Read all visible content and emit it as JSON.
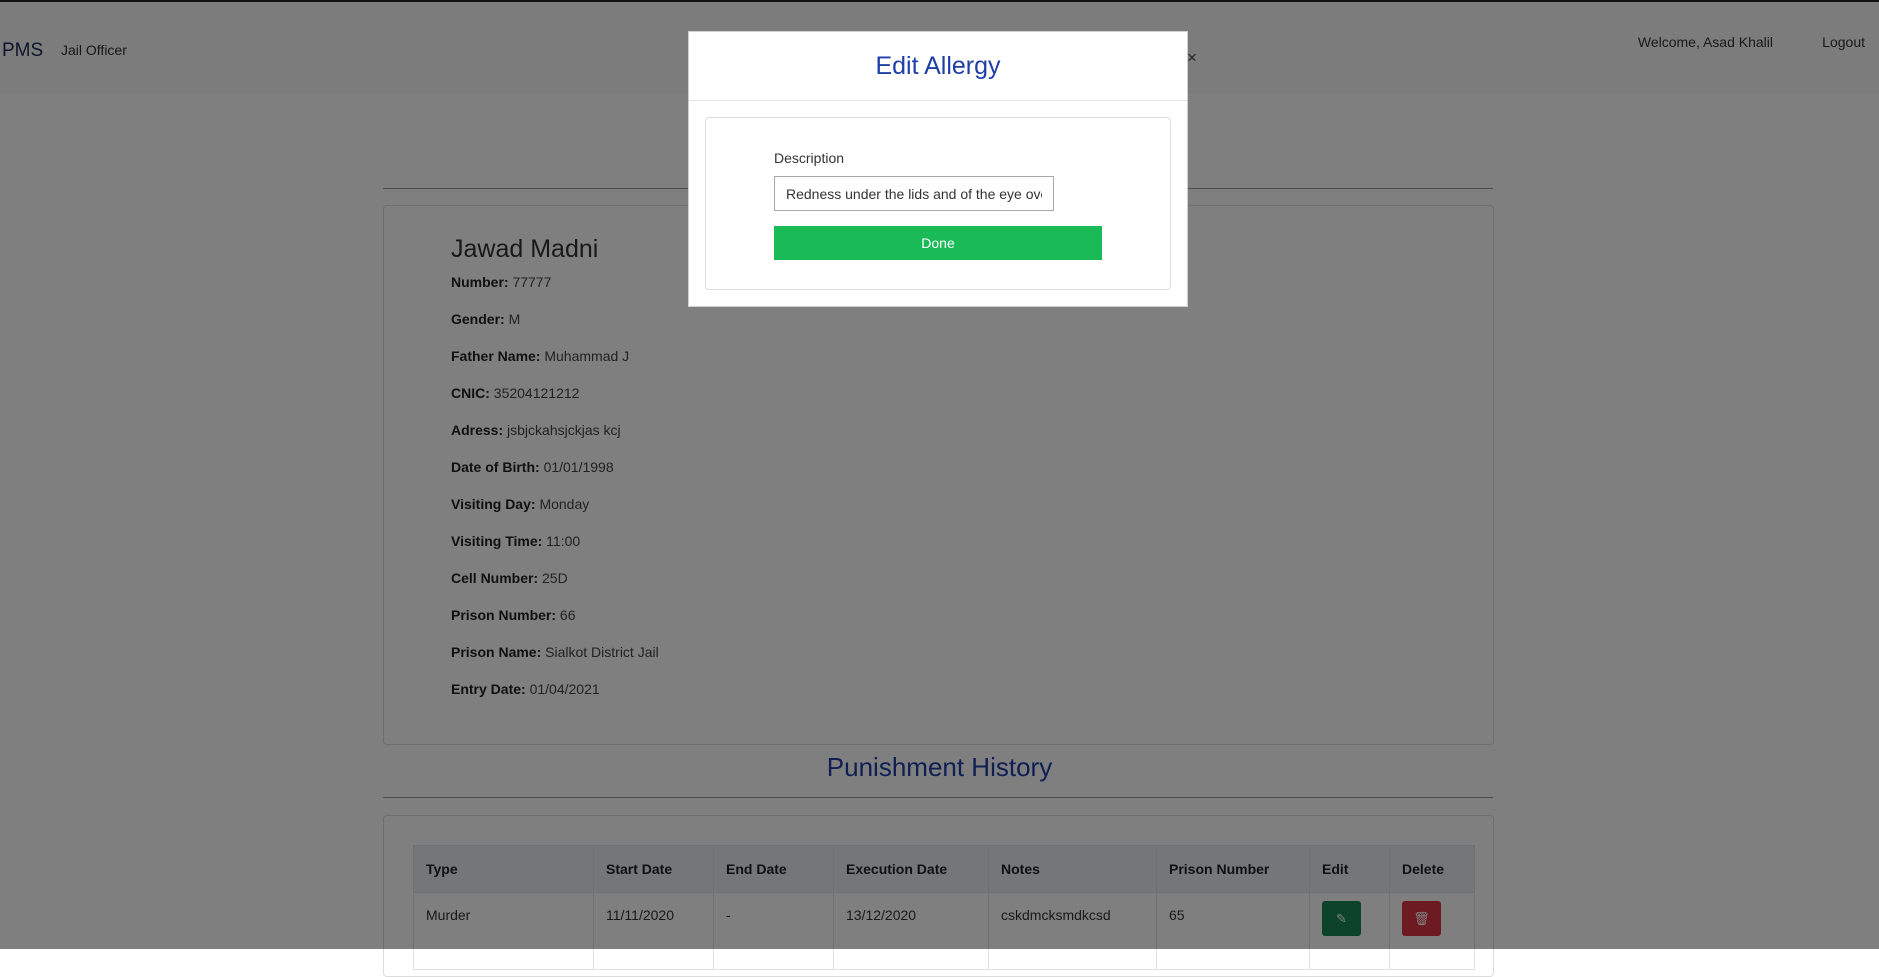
{
  "navbar": {
    "brand": "PMS",
    "role_link": "Jail Officer",
    "welcome": "Welcome, Asad Khalil",
    "logout": "Logout"
  },
  "profile": {
    "name": "Jawad Madni",
    "fields": [
      {
        "label": "Number:",
        "value": "77777"
      },
      {
        "label": "Gender:",
        "value": "M"
      },
      {
        "label": "Father Name:",
        "value": "Muhammad J"
      },
      {
        "label": "CNIC:",
        "value": "35204121212"
      },
      {
        "label": "Adress:",
        "value": "jsbjckahsjckjas kcj"
      },
      {
        "label": "Date of Birth:",
        "value": "01/01/1998"
      },
      {
        "label": "Visiting Day:",
        "value": "Monday"
      },
      {
        "label": "Visiting Time:",
        "value": "11:00"
      },
      {
        "label": "Cell Number:",
        "value": "25D"
      },
      {
        "label": "Prison Number:",
        "value": "66"
      },
      {
        "label": "Prison Name:",
        "value": "Sialkot District Jail"
      },
      {
        "label": "Entry Date:",
        "value": "01/04/2021"
      }
    ]
  },
  "punishment": {
    "title": "Punishment History",
    "headers": [
      "Type",
      "Start Date",
      "End Date",
      "Execution Date",
      "Notes",
      "Prison Number",
      "Edit",
      "Delete"
    ],
    "rows": [
      {
        "type": "Murder",
        "start": "11/11/2020",
        "end": "-",
        "execution": "13/12/2020",
        "notes": "cskdmcksmdkcsd",
        "prison_number": "65"
      }
    ]
  },
  "modal": {
    "title": "Edit Allergy",
    "close": "×",
    "description_label": "Description",
    "description_value": "Redness under the lids and of the eye overall",
    "done_label": "Done"
  },
  "colors": {
    "title_blue": "#1f3fa8",
    "done_green": "#1aba57",
    "edit_green": "#198754",
    "delete_red": "#dc3545"
  },
  "icons": {
    "edit": "edit-icon",
    "delete": "trash-icon"
  }
}
